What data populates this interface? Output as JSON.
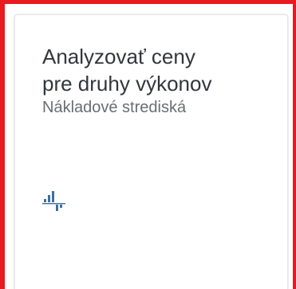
{
  "tile": {
    "title_line1": "Analyzovať ceny",
    "title_line2": "pre druhy výkonov",
    "subtitle": "Nákladové strediská",
    "icon": "variance-chart-icon",
    "icon_color": "#3f6e9c"
  },
  "focus_outline_color": "#e8191f"
}
